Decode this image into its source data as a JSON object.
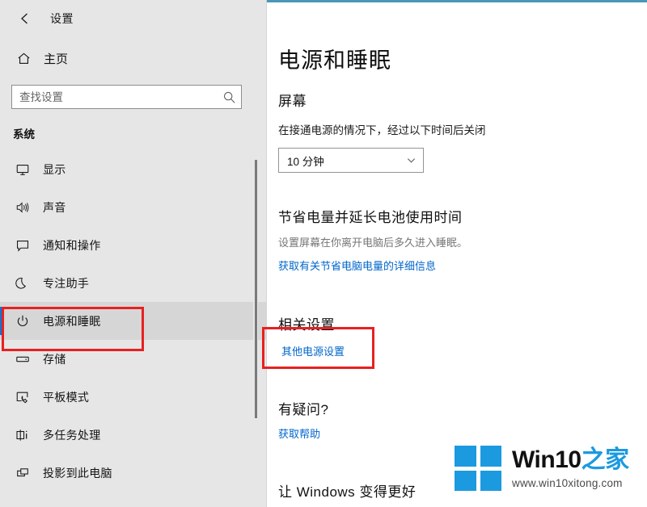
{
  "window": {
    "title": "设置",
    "back_icon": "back-arrow-icon",
    "accent_color": "#4a96b5",
    "controls": {
      "minimize": "minimize-icon",
      "maximize": "maximize-icon",
      "close": "close-icon"
    }
  },
  "sidebar": {
    "home": {
      "label": "主页",
      "icon": "home-icon"
    },
    "search": {
      "value": "",
      "placeholder": "查找设置",
      "icon": "search-icon"
    },
    "section_title": "系统",
    "selected_index": 4,
    "selection_color": "#0078d7",
    "items": [
      {
        "label": "显示",
        "icon": "monitor-icon"
      },
      {
        "label": "声音",
        "icon": "speaker-icon"
      },
      {
        "label": "通知和操作",
        "icon": "notification-icon"
      },
      {
        "label": "专注助手",
        "icon": "moon-icon"
      },
      {
        "label": "电源和睡眠",
        "icon": "power-icon"
      },
      {
        "label": "存储",
        "icon": "storage-icon"
      },
      {
        "label": "平板模式",
        "icon": "tablet-mode-icon"
      },
      {
        "label": "多任务处理",
        "icon": "multitasking-icon"
      },
      {
        "label": "投影到此电脑",
        "icon": "project-to-pc-icon"
      }
    ]
  },
  "main": {
    "page_title": "电源和睡眠",
    "screen": {
      "heading": "屏幕",
      "description": "在接通电源的情况下，经过以下时间后关闭",
      "dropdown_value": "10 分钟",
      "dropdown_icon": "chevron-down-icon"
    },
    "battery": {
      "heading": "节省电量并延长电池使用时间",
      "description": "设置屏幕在你离开电脑后多久进入睡眠。",
      "link": "获取有关节省电脑电量的详细信息"
    },
    "related": {
      "heading": "相关设置",
      "link": "其他电源设置"
    },
    "question": {
      "heading": "有疑问?",
      "link": "获取帮助"
    },
    "improve": {
      "heading": "让 Windows 变得更好"
    }
  },
  "annotations": {
    "color": "#e82020",
    "boxes": [
      "电源和睡眠",
      "其他电源设置"
    ]
  },
  "watermark": {
    "brand_dark": "Win10",
    "brand_blue": "之家",
    "url": "www.win10xitong.com",
    "logo_color": "#1b9ae0"
  }
}
